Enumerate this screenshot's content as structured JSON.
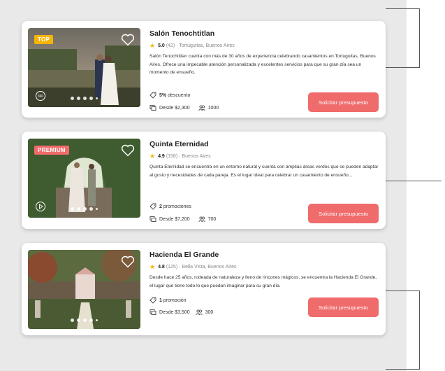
{
  "colors": {
    "accent": "#f06b6b",
    "star": "#f5b400",
    "top_badge": "#f5b400",
    "premium_badge": "#f06b6b"
  },
  "venues": [
    {
      "name": "Salón Tenochtitlan",
      "badge": "TOP",
      "rating": "5.0",
      "reviews": "(42)",
      "location": "· Tortuguitas, Buenos Aires",
      "description": "Salón Tenochtitlan cuenta con más de 30 años de experiencia celebrando casamientos en Tortuguitas, Buenos Aires. Ofrece una impecable atención personalizada y excelentes servicios para que su gran día sea un momento de ensueño.",
      "promo_strong": "5%",
      "promo_text": "descuento",
      "price": "Desde $2,300",
      "guests": "1000",
      "media_icon": "360-view-icon",
      "cta": "Solicitar presupuesto"
    },
    {
      "name": "Quinta Eternidad",
      "badge": "PREMIUM",
      "rating": "4.9",
      "reviews": "(158)",
      "location": "· Buenos Aires",
      "description": "Quinta Eternidad se encuentra en un entorno natural y cuenta con amplias áreas verdes que se pueden adaptar al gusto y necesidades de cada pareja. Es el lugar ideal para celebrar un casamiento de ensueño...",
      "promo_strong": "2",
      "promo_text": "promociones",
      "price": "Desde $7,200",
      "guests": "700",
      "media_icon": "play-icon",
      "cta": "Solicitar presupuesto"
    },
    {
      "name": "Hacienda El Grande",
      "badge": "",
      "rating": "4.8",
      "reviews": "(125)",
      "location": "· Bella Vista, Buenos Aires",
      "description": "Desde hace 25 años, rodeada de naturaleza y lleno de rincones mágicos, se encuentra la Hacienda El Grande, el lugar que tiene todo lo que puedan imaginar para su gran día.",
      "promo_strong": "1",
      "promo_text": "promoción",
      "price": "Desde $3,500",
      "guests": "300",
      "media_icon": "",
      "cta": "Solicitar presupuesto"
    }
  ]
}
